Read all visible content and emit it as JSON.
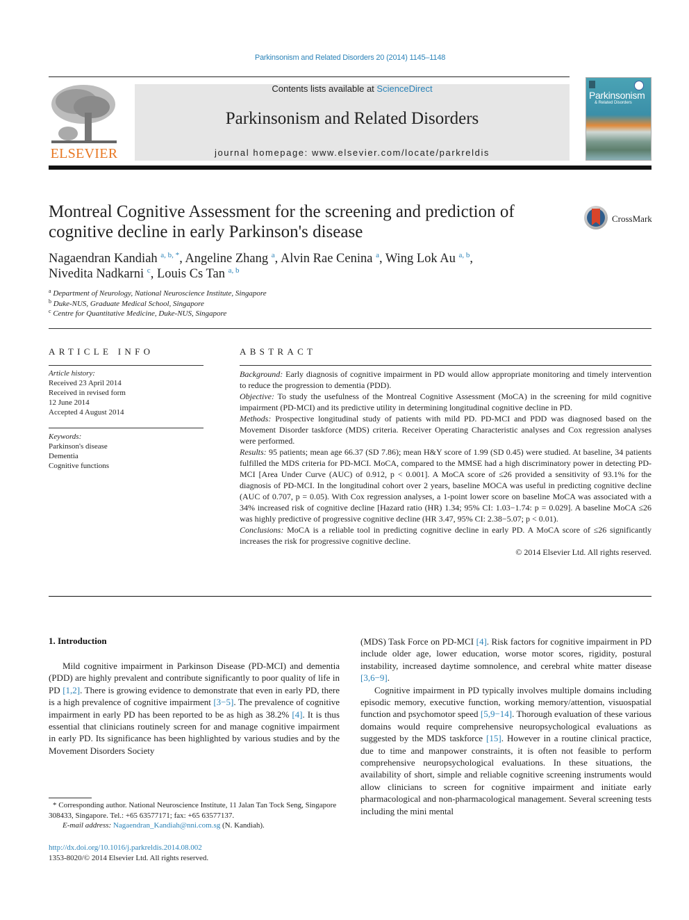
{
  "header": {
    "journal_reference": "Parkinsonism and Related Disorders 20 (2014) 1145–1148",
    "contents_prefix": "Contents lists available at ",
    "contents_link": "ScienceDirect",
    "journal_name": "Parkinsonism and Related Disorders",
    "homepage": "journal homepage: www.elsevier.com/locate/parkreldis",
    "publisher_logo_text": "ELSEVIER",
    "cover_title": "Parkinsonism",
    "cover_subtitle": "& Related Disorders",
    "crossmark_label": "CrossMark"
  },
  "article": {
    "title": "Montreal Cognitive Assessment for the screening and prediction of cognitive decline in early Parkinson's disease",
    "authors": [
      {
        "name": "Nagaendran Kandiah",
        "affil": "a, b, *",
        "sep": ", "
      },
      {
        "name": "Angeline Zhang",
        "affil": "a",
        "sep": ", "
      },
      {
        "name": "Alvin Rae Cenina",
        "affil": "a",
        "sep": ", "
      },
      {
        "name": "Wing Lok Au",
        "affil": "a, b",
        "sep": ","
      },
      {
        "name": "Nivedita Nadkarni",
        "affil": "c",
        "sep": ", "
      },
      {
        "name": "Louis Cs Tan",
        "affil": "a, b",
        "sep": ""
      }
    ],
    "affiliations": [
      {
        "key": "a",
        "text": "Department of Neurology, National Neuroscience Institute, Singapore"
      },
      {
        "key": "b",
        "text": "Duke-NUS, Graduate Medical School, Singapore"
      },
      {
        "key": "c",
        "text": "Centre for Quantitative Medicine, Duke-NUS, Singapore"
      }
    ]
  },
  "article_info": {
    "heading": "ARTICLE INFO",
    "history_label": "Article history:",
    "history": [
      "Received 23 April 2014",
      "Received in revised form",
      "12 June 2014",
      "Accepted 4 August 2014"
    ],
    "keywords_label": "Keywords:",
    "keywords": [
      "Parkinson's disease",
      "Dementia",
      "Cognitive functions"
    ]
  },
  "abstract": {
    "heading": "ABSTRACT",
    "sections": [
      {
        "label": "Background:",
        "text": " Early diagnosis of cognitive impairment in PD would allow appropriate monitoring and timely intervention to reduce the progression to dementia (PDD)."
      },
      {
        "label": "Objective:",
        "text": " To study the usefulness of the Montreal Cognitive Assessment (MoCA) in the screening for mild cognitive impairment (PD-MCI) and its predictive utility in determining longitudinal cognitive decline in PD."
      },
      {
        "label": "Methods:",
        "text": " Prospective longitudinal study of patients with mild PD. PD-MCI and PDD was diagnosed based on the Movement Disorder taskforce (MDS) criteria. Receiver Operating Characteristic analyses and Cox regression analyses were performed."
      },
      {
        "label": "Results:",
        "text": " 95 patients; mean age 66.37 (SD 7.86); mean H&Y score of 1.99 (SD 0.45) were studied. At baseline, 34 patients fulfilled the MDS criteria for PD-MCI. MoCA, compared to the MMSE had a high discriminatory power in detecting PD-MCI [Area Under Curve (AUC) of 0.912, p < 0.001]. A MoCA score of ≤26 provided a sensitivity of 93.1% for the diagnosis of PD-MCI. In the longitudinal cohort over 2 years, baseline MOCA was useful in predicting cognitive decline (AUC of 0.707, p = 0.05). With Cox regression analyses, a 1-point lower score on baseline MoCA was associated with a 34% increased risk of cognitive decline [Hazard ratio (HR) 1.34; 95% CI: 1.03−1.74: p = 0.029]. A baseline MoCA ≤26 was highly predictive of progressive cognitive decline (HR 3.47, 95% CI: 2.38−5.07; p < 0.01)."
      },
      {
        "label": "Conclusions:",
        "text": " MoCA is a reliable tool in predicting cognitive decline in early PD. A MoCA score of ≤26 significantly increases the risk for progressive cognitive decline."
      }
    ],
    "copyright": "© 2014 Elsevier Ltd. All rights reserved."
  },
  "introduction": {
    "heading": "1.  Introduction",
    "left_column": [
      {
        "text": "Mild cognitive impairment in Parkinson Disease (PD-MCI) and dementia (PDD) are highly prevalent and contribute significantly to poor quality of life in PD ",
        "ref": "[1,2]",
        "after": ". There is growing evidence to demonstrate that even in early PD, there is a high prevalence of cognitive impairment "
      },
      {
        "ref": "[3−5]",
        "after": ". The prevalence of cognitive impairment in early PD has been reported to be as high as 38.2% "
      },
      {
        "ref": "[4]",
        "after": ". It is thus essential that clinicians routinely screen for and manage cognitive impairment in early PD. Its significance has been highlighted by various studies and by the Movement Disorders Society"
      }
    ],
    "right_column": {
      "p1_start": "(MDS) Task Force on PD-MCI ",
      "p1_ref1": "[4]",
      "p1_mid": ". Risk factors for cognitive impairment in PD include older age, lower education, worse motor scores, rigidity, postural instability, increased daytime somnolence, and cerebral white matter disease ",
      "p1_ref2": "[3,6−9]",
      "p1_end": ".",
      "p2_start": "Cognitive impairment in PD typically involves multiple domains including episodic memory, executive function, working memory/attention, visuospatial function and psychomotor speed ",
      "p2_ref1": "[5,9−14]",
      "p2_mid": ". Thorough evaluation of these various domains would require comprehensive neuropsychological evaluations as suggested by the MDS taskforce ",
      "p2_ref2": "[15]",
      "p2_end": ". However in a routine clinical practice, due to time and manpower constraints, it is often not feasible to perform comprehensive neuropsychological evaluations. In these situations, the availability of short, simple and reliable cognitive screening instruments would allow clinicians to screen for cognitive impairment and initiate early pharmacological and non-pharmacological management. Several screening tests including the mini mental"
    }
  },
  "footnote": {
    "corresponding": "* Corresponding author. National Neuroscience Institute, 11 Jalan Tan Tock Seng, Singapore 308433, Singapore. Tel.: +65 63577171; fax: +65 63577137.",
    "email_label": "E-mail address:",
    "email": "Nagaendran_Kandiah@nni.com.sg",
    "email_suffix": " (N. Kandiah).",
    "doi": "http://dx.doi.org/10.1016/j.parkreldis.2014.08.002",
    "issn": "1353-8020/© 2014 Elsevier Ltd. All rights reserved."
  }
}
